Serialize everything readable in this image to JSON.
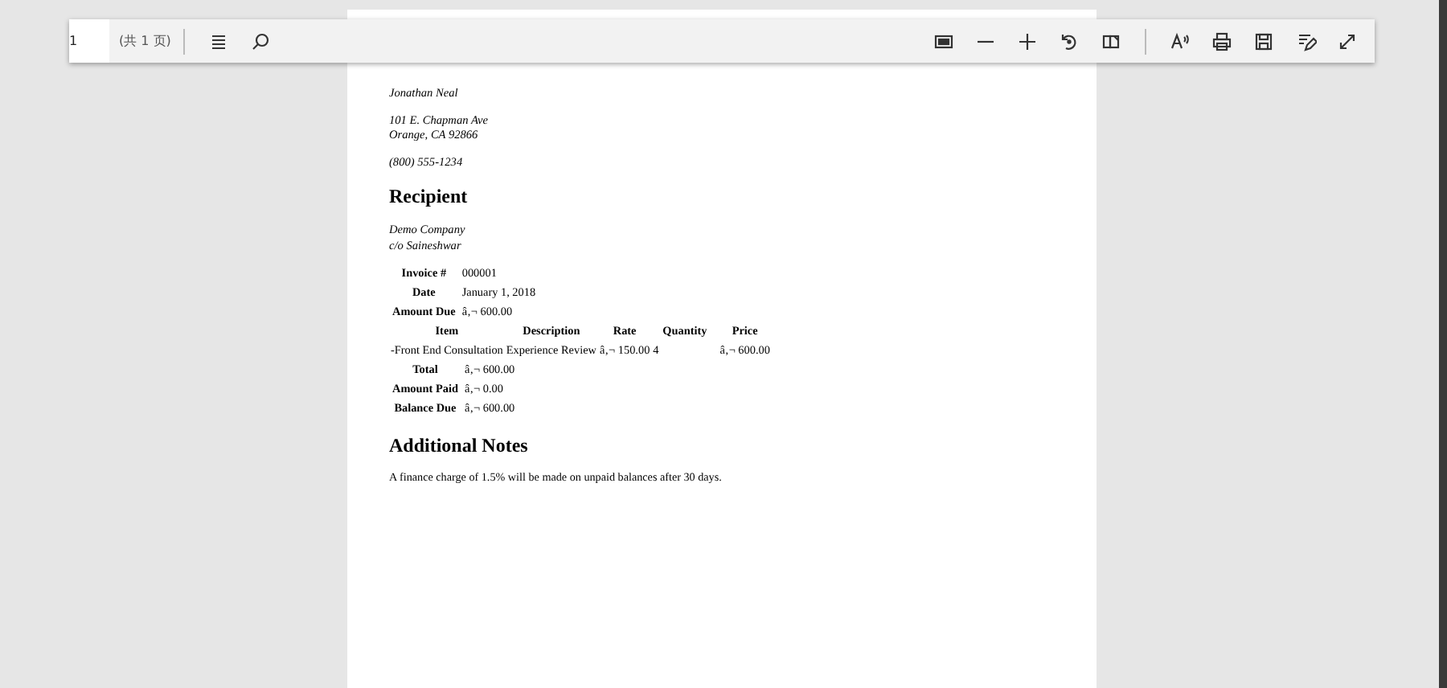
{
  "toolbar": {
    "page_number": "1",
    "page_count": "(共 1 页)"
  },
  "document": {
    "sender": {
      "name": "Jonathan Neal",
      "address": [
        "101 E. Chapman Ave",
        "Orange, CA 92866"
      ],
      "phone": "(800) 555-1234"
    },
    "recipient_heading": "Recipient",
    "recipient": [
      "Demo Company",
      "c/o Saineshwar"
    ],
    "meta": [
      {
        "label": "Invoice #",
        "value": "000001"
      },
      {
        "label": "Date",
        "value": "January 1, 2018"
      },
      {
        "label": "Amount Due",
        "value": "â‚¬ 600.00"
      }
    ],
    "items": {
      "columns": [
        "Item",
        "Description",
        "Rate",
        "Quantity",
        "Price"
      ],
      "rows": [
        [
          "-Front End Consultation",
          "Experience Review",
          "â‚¬ 150.00",
          "4",
          "â‚¬ 600.00"
        ]
      ]
    },
    "totals": [
      {
        "label": "Total",
        "value": "â‚¬ 600.00"
      },
      {
        "label": "Amount Paid",
        "value": "â‚¬ 0.00"
      },
      {
        "label": "Balance Due",
        "value": "â‚¬ 600.00"
      }
    ],
    "notes_heading": "Additional Notes",
    "notes": "A finance charge of 1.5% will be made on unpaid balances after 30 days."
  }
}
